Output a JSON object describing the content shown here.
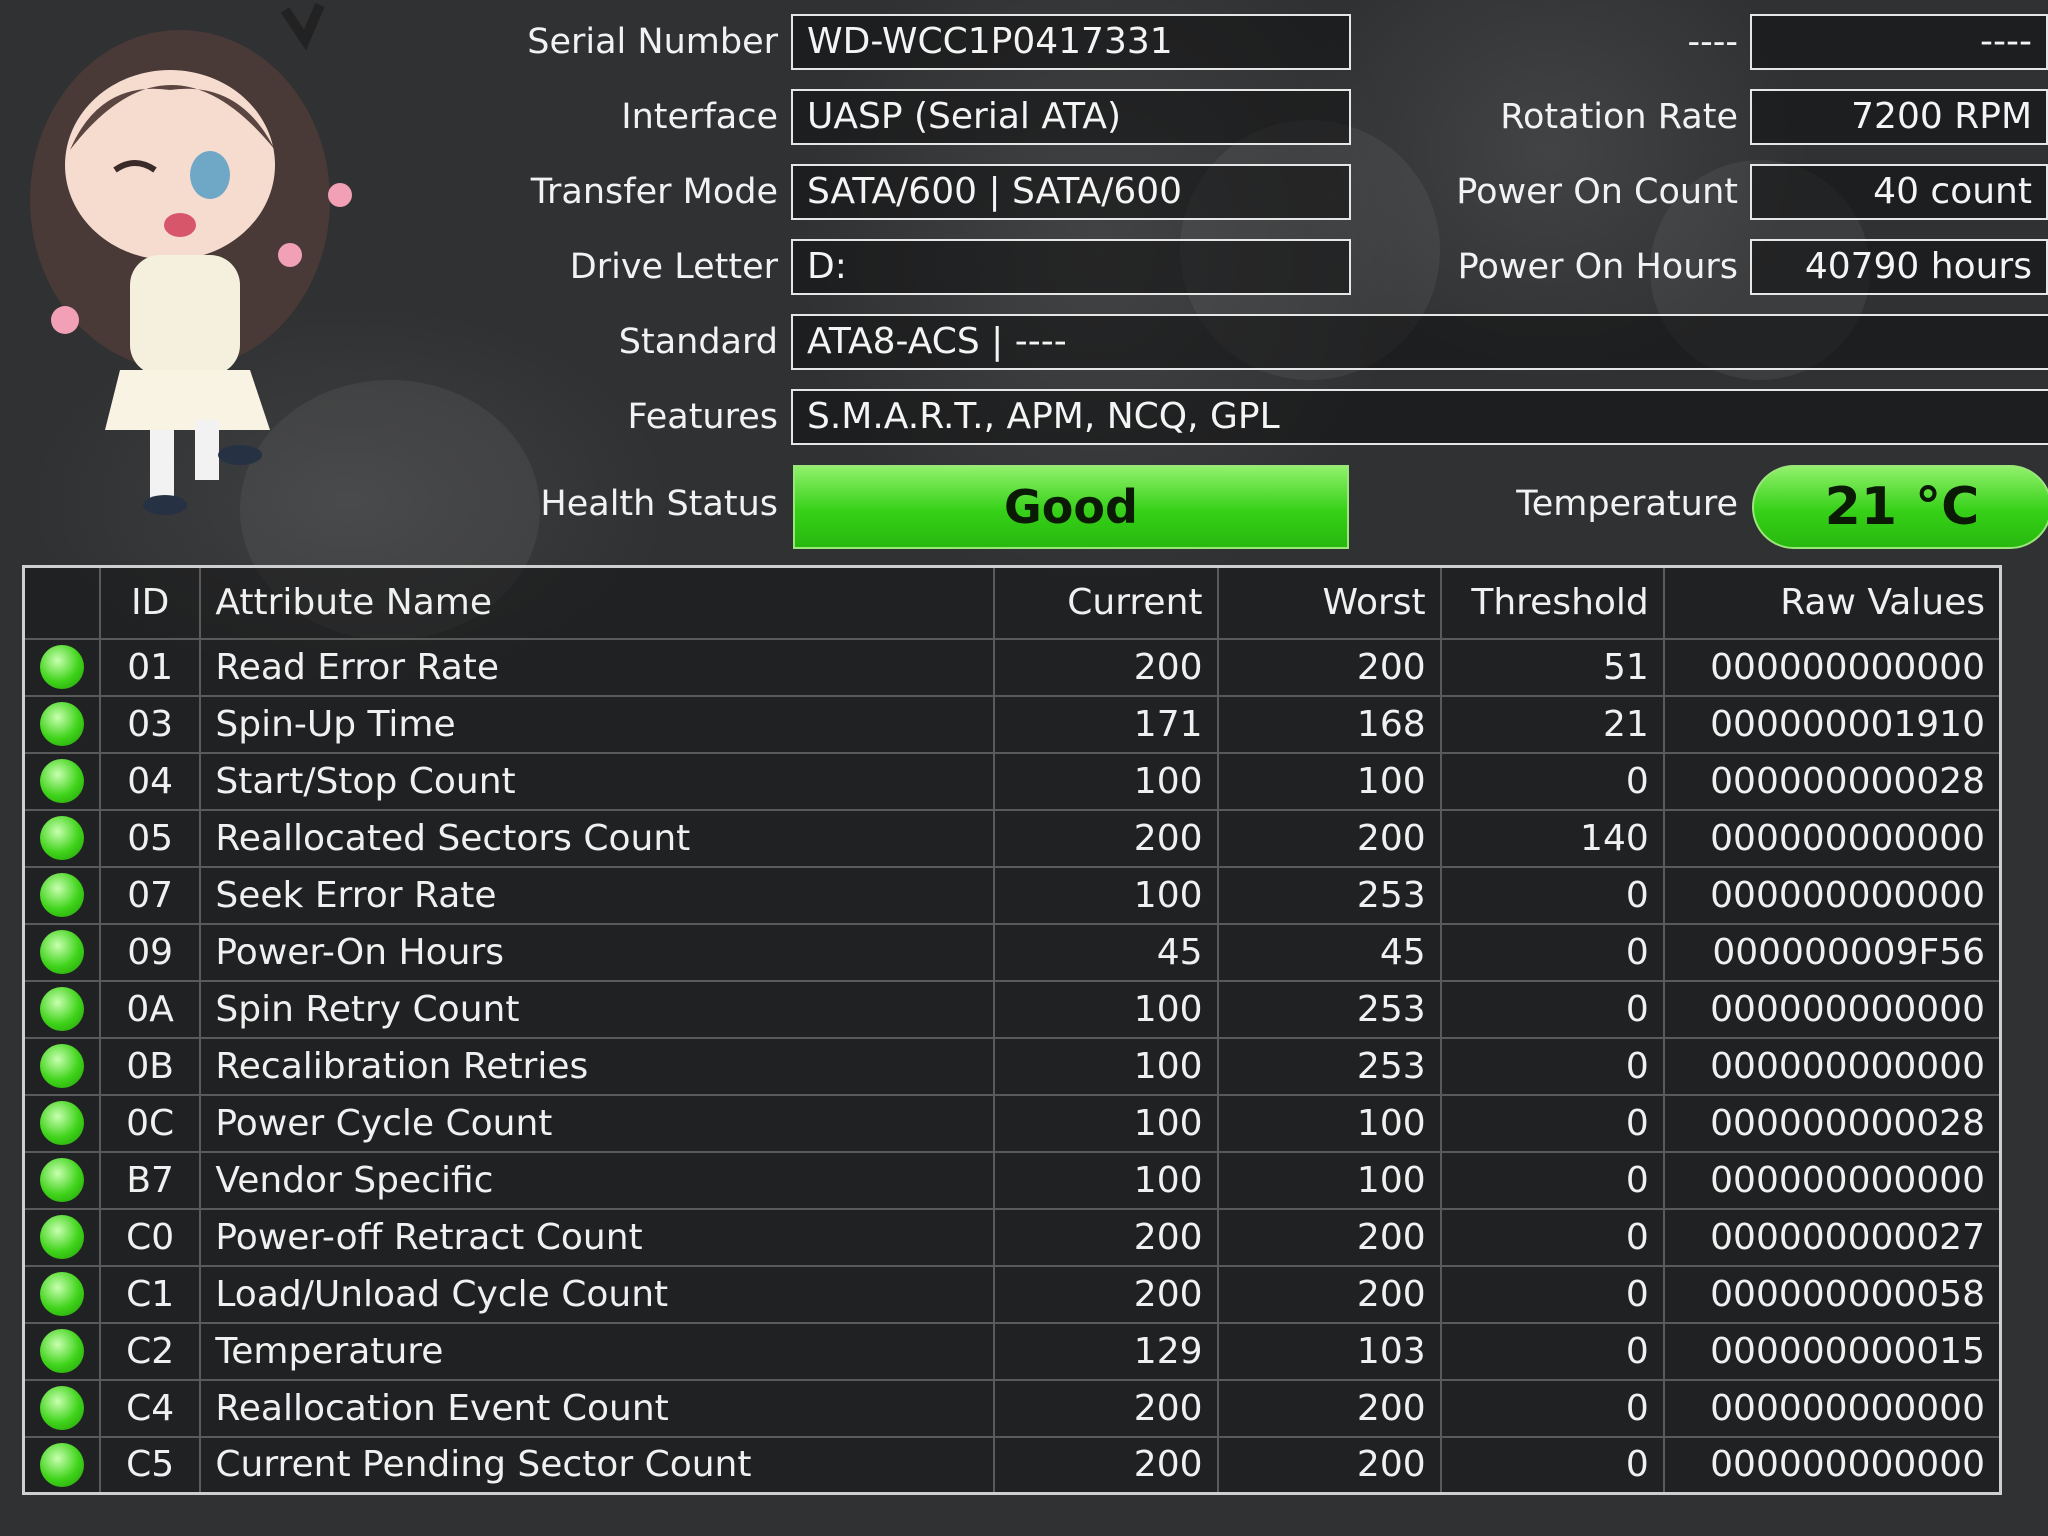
{
  "info": {
    "serial_label": "Serial Number",
    "serial_value": "WD-WCC1P0417331",
    "interface_label": "Interface",
    "interface_value": "UASP (Serial ATA)",
    "transfer_label": "Transfer Mode",
    "transfer_value": "SATA/600 | SATA/600",
    "drive_letter_label": "Drive Letter",
    "drive_letter_value": "D:",
    "standard_label": "Standard",
    "standard_value": "ATA8-ACS | ----",
    "features_label": "Features",
    "features_value": "S.M.A.R.T., APM, NCQ, GPL",
    "health_label": "Health Status",
    "health_value": "Good",
    "unknown_label": "----",
    "unknown_value": "----",
    "rotation_label": "Rotation Rate",
    "rotation_value": "7200 RPM",
    "power_count_label": "Power On Count",
    "power_count_value": "40 count",
    "power_hours_label": "Power On Hours",
    "power_hours_value": "40790 hours",
    "temp_label": "Temperature",
    "temp_value": "21 °C"
  },
  "table": {
    "headers": [
      "",
      "ID",
      "Attribute Name",
      "Current",
      "Worst",
      "Threshold",
      "Raw Values"
    ],
    "rows": [
      [
        "01",
        "Read Error Rate",
        "200",
        "200",
        "51",
        "000000000000"
      ],
      [
        "03",
        "Spin-Up Time",
        "171",
        "168",
        "21",
        "000000001910"
      ],
      [
        "04",
        "Start/Stop Count",
        "100",
        "100",
        "0",
        "000000000028"
      ],
      [
        "05",
        "Reallocated Sectors Count",
        "200",
        "200",
        "140",
        "000000000000"
      ],
      [
        "07",
        "Seek Error Rate",
        "100",
        "253",
        "0",
        "000000000000"
      ],
      [
        "09",
        "Power-On Hours",
        "45",
        "45",
        "0",
        "000000009F56"
      ],
      [
        "0A",
        "Spin Retry Count",
        "100",
        "253",
        "0",
        "000000000000"
      ],
      [
        "0B",
        "Recalibration Retries",
        "100",
        "253",
        "0",
        "000000000000"
      ],
      [
        "0C",
        "Power Cycle Count",
        "100",
        "100",
        "0",
        "000000000028"
      ],
      [
        "B7",
        "Vendor Specific",
        "100",
        "100",
        "0",
        "000000000000"
      ],
      [
        "C0",
        "Power-off Retract Count",
        "200",
        "200",
        "0",
        "000000000027"
      ],
      [
        "C1",
        "Load/Unload Cycle Count",
        "200",
        "200",
        "0",
        "000000000058"
      ],
      [
        "C2",
        "Temperature",
        "129",
        "103",
        "0",
        "000000000015"
      ],
      [
        "C4",
        "Reallocation Event Count",
        "200",
        "200",
        "0",
        "000000000000"
      ],
      [
        "C5",
        "Current Pending Sector Count",
        "200",
        "200",
        "0",
        "000000000000"
      ]
    ]
  },
  "colors": {
    "good": "#36d118",
    "background": "#2f3133"
  }
}
